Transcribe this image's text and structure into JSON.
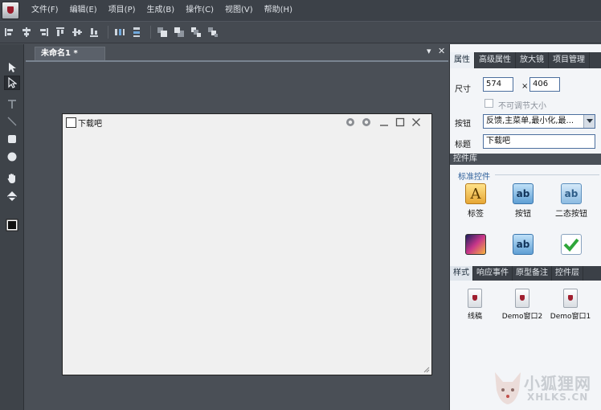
{
  "menu": [
    "文件(F)",
    "编辑(E)",
    "项目(P)",
    "生成(B)",
    "操作(C)",
    "视图(V)",
    "帮助(H)"
  ],
  "toolbar": {
    "icons": [
      "align-left-icon",
      "align-center-icon",
      "align-right-icon",
      "align-top-icon",
      "align-middle-icon",
      "align-bottom-icon",
      "distribute-horizontal-icon",
      "distribute-vertical-icon",
      "bring-front-icon",
      "send-back-icon",
      "bring-forward-icon",
      "send-backward-icon"
    ]
  },
  "left_tools": [
    "pointer-icon",
    "direct-select-icon",
    "text-icon",
    "line-icon",
    "rectangle-icon",
    "ellipse-icon",
    "hand-icon",
    "fill-bucket-icon",
    "color-swatch-icon"
  ],
  "document_tab": {
    "label": "未命名1 *",
    "dropdown": "▾",
    "close": "✕"
  },
  "design_window": {
    "title": "下载吧",
    "width": "574",
    "height": "406"
  },
  "properties": {
    "tabs": [
      "属性",
      "高级属性",
      "放大镜",
      "项目管理"
    ],
    "size_label": "尺寸",
    "times": "×",
    "width_value": "574",
    "height_value": "406",
    "fixed_size_label": "不可调节大小",
    "buttons_label": "按钮",
    "buttons_value": "反馈,主菜单,最小化,最...",
    "title_label": "标题",
    "title_value": "下载吧"
  },
  "library": {
    "header": "控件库",
    "group": "标准控件",
    "items": [
      "标签",
      "按钮",
      "二态按钮"
    ]
  },
  "bottom_tabs": [
    "样式",
    "响应事件",
    "原型备注",
    "控件层"
  ],
  "styles": [
    "线稿",
    "Demo窗口2",
    "Demo窗口1"
  ],
  "watermark": {
    "text": "小狐狸网",
    "url": "XHLKS.CN"
  },
  "colors": {
    "accent": "#2d5f9a",
    "panel": "#f3f5f8",
    "chrome": "#4a4f56"
  }
}
